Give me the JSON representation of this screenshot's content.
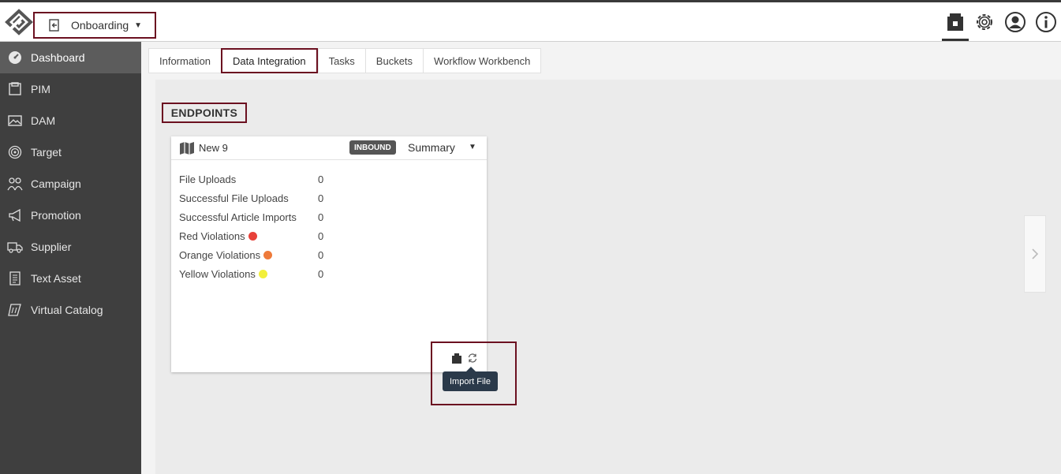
{
  "header": {
    "module": "Onboarding",
    "icons": [
      "inbox-icon",
      "gear-icon",
      "user-icon",
      "info-icon"
    ]
  },
  "sidebar": {
    "items": [
      {
        "label": "Dashboard",
        "icon": "dashboard-icon",
        "active": true
      },
      {
        "label": "PIM",
        "icon": "pim-icon"
      },
      {
        "label": "DAM",
        "icon": "image-icon"
      },
      {
        "label": "Target",
        "icon": "target-icon"
      },
      {
        "label": "Campaign",
        "icon": "campaign-icon"
      },
      {
        "label": "Promotion",
        "icon": "megaphone-icon"
      },
      {
        "label": "Supplier",
        "icon": "truck-icon"
      },
      {
        "label": "Text Asset",
        "icon": "document-icon"
      },
      {
        "label": "Virtual Catalog",
        "icon": "catalog-icon"
      }
    ]
  },
  "tabs": [
    {
      "label": "Information"
    },
    {
      "label": "Data Integration",
      "active": true
    },
    {
      "label": "Tasks"
    },
    {
      "label": "Buckets"
    },
    {
      "label": "Workflow Workbench"
    }
  ],
  "endpoints": {
    "title": "ENDPOINTS",
    "card": {
      "name": "New 9",
      "badge": "INBOUND",
      "view": "Summary",
      "stats": [
        {
          "label": "File Uploads",
          "value": "0"
        },
        {
          "label": "Successful File Uploads",
          "value": "0"
        },
        {
          "label": "Successful Article Imports",
          "value": "0"
        },
        {
          "label": "Red Violations",
          "value": "0",
          "dot": "#e8413a"
        },
        {
          "label": "Orange Violations",
          "value": "0",
          "dot": "#ee7a3a"
        },
        {
          "label": "Yellow Violations",
          "value": "0",
          "dot": "#f2ef3a"
        }
      ],
      "tooltip": "Import File"
    }
  },
  "colors": {
    "highlight": "#6b1020",
    "sidebar_bg": "#3f3f3f",
    "sidebar_active": "#5c5c5c",
    "badge_bg": "#555555",
    "tooltip_bg": "#2b3a4a"
  }
}
